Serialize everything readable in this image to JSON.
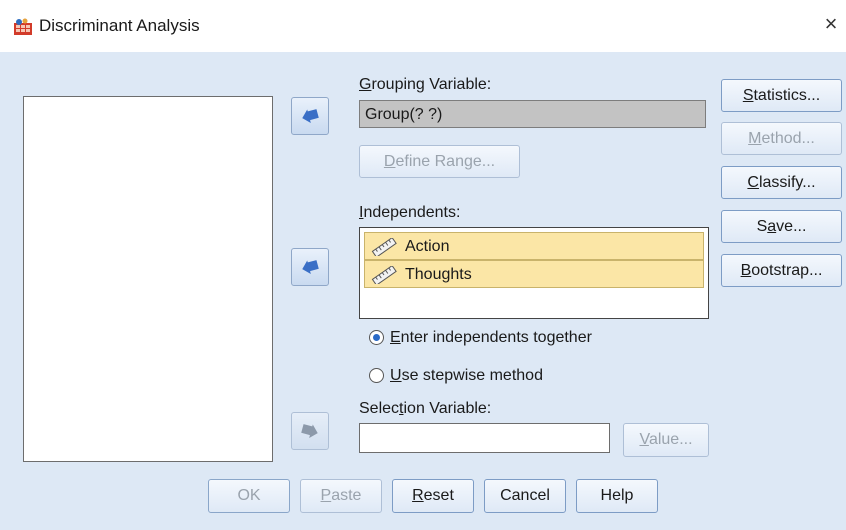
{
  "window": {
    "title": "Discriminant Analysis",
    "close_glyph": "×"
  },
  "grouping": {
    "label": "Grouping Variable:",
    "label_accel": "G",
    "label_rest": "rouping Variable:",
    "value": "Group(? ?)"
  },
  "define_range": {
    "accel": "D",
    "rest": "efine Range..."
  },
  "independents": {
    "label_accel": "I",
    "label_rest": "ndependents:",
    "items": [
      "Action",
      "Thoughts"
    ]
  },
  "method_radios": [
    {
      "accel": "E",
      "rest": "nter independents together",
      "checked": true
    },
    {
      "accel": "U",
      "rest": "se stepwise method",
      "checked": false
    }
  ],
  "selection": {
    "label_pre": "Selec",
    "label_accel": "t",
    "label_rest": "ion Variable:",
    "value": ""
  },
  "value_button": {
    "accel": "V",
    "rest": "alue..."
  },
  "side_buttons": {
    "statistics": {
      "accel": "S",
      "rest": "tatistics..."
    },
    "method": {
      "accel": "M",
      "rest": "ethod..."
    },
    "classify": {
      "accel": "C",
      "rest": "lassify..."
    },
    "save": {
      "pre": "S",
      "accel": "a",
      "rest": "ve..."
    },
    "bootstrap": {
      "accel": "B",
      "rest": "ootstrap..."
    }
  },
  "bottom_buttons": {
    "ok": "OK",
    "paste": {
      "accel": "P",
      "rest": "aste"
    },
    "reset": {
      "accel": "R",
      "rest": "eset"
    },
    "cancel": "Cancel",
    "help": "Help"
  },
  "colors": {
    "dialog_bg": "#dde8f5",
    "selected_item": "#fbe6a6",
    "arrow_blue": "#3a6fc6"
  }
}
